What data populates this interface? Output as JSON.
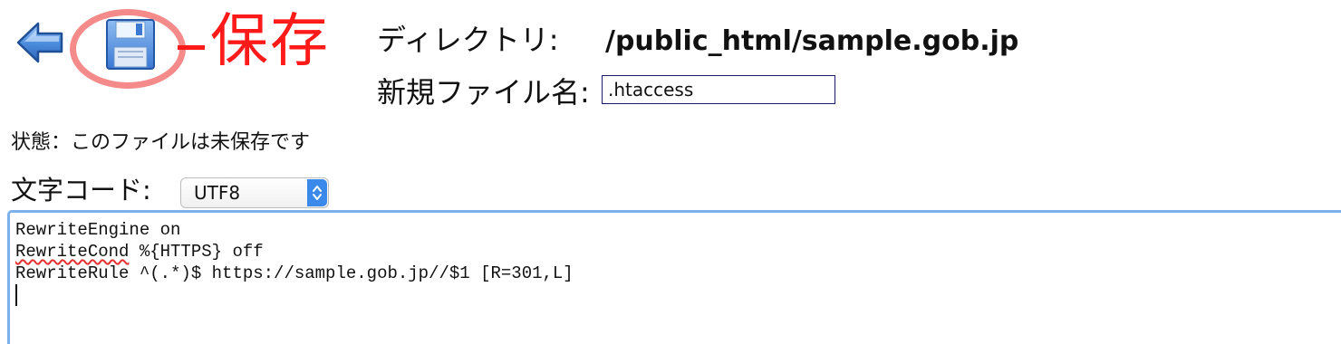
{
  "toolbar": {
    "back_icon": "back-arrow-icon",
    "save_icon": "floppy-disk-icon",
    "annotation_text": "保存",
    "annotation_color": "#ff1a1a",
    "ring_color": "#f48a8a"
  },
  "directory": {
    "label": "ディレクトリ:",
    "path": "/public_html/sample.gob.jp"
  },
  "new_file": {
    "label": "新規ファイル名:",
    "value": ".htaccess"
  },
  "status": {
    "text": "状態：このファイルは未保存です"
  },
  "encoding": {
    "label": "文字コード:",
    "selected": "UTF8",
    "accent_color": "#3b89ea"
  },
  "editor": {
    "lines": [
      "RewriteEngine on",
      "RewriteCond",
      " %{HTTPS} off",
      "RewriteRule ^(.*)$ https://sample.gob.jp//$1 [R=301,L]"
    ],
    "focus_border_color": "#7fb0ee"
  }
}
